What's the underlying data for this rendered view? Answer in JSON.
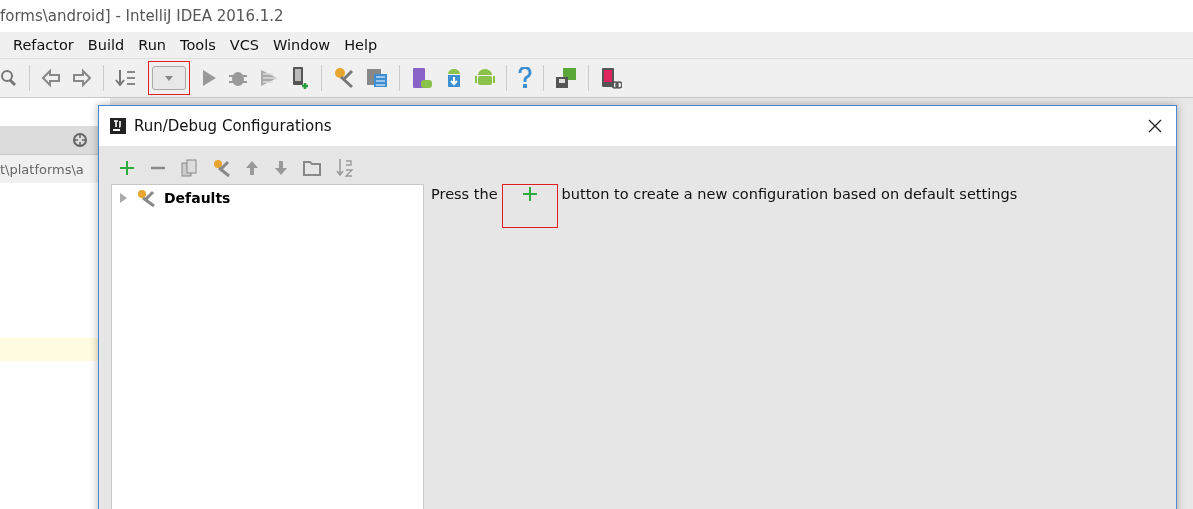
{
  "window": {
    "title": "forms\\android] - IntelliJ IDEA 2016.1.2"
  },
  "menu": [
    "Refactor",
    "Build",
    "Run",
    "Tools",
    "VCS",
    "Window",
    "Help"
  ],
  "toolbar": {
    "run_config_dropdown": {
      "highlighted": true
    }
  },
  "editor": {
    "path": "t\\platforms\\a"
  },
  "dialog": {
    "title": "Run/Debug Configurations",
    "tree": [
      {
        "label": "Defaults",
        "expanded": false
      }
    ],
    "message": {
      "before": "Press the",
      "after": "button to create a new configuration based on default settings",
      "plus_highlighted": true
    }
  }
}
